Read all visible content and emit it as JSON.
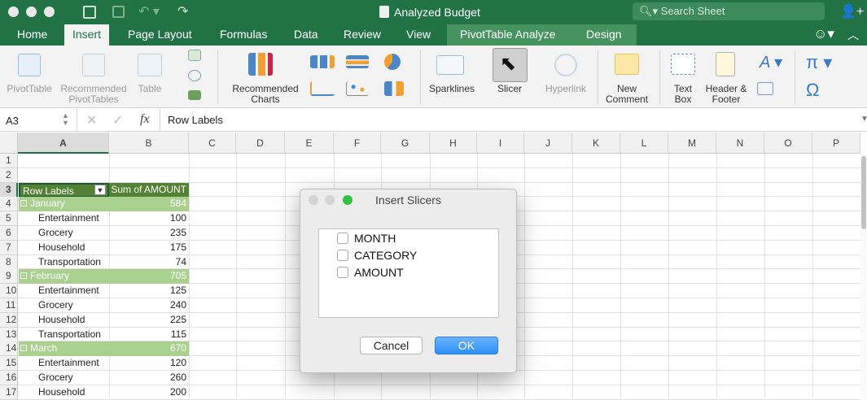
{
  "window": {
    "title": "Analyzed Budget",
    "search_placeholder": "Search Sheet"
  },
  "tabs": [
    "Home",
    "Insert",
    "Page Layout",
    "Formulas",
    "Data",
    "Review",
    "View",
    "PivotTable Analyze",
    "Design"
  ],
  "active_tab": "Insert",
  "ribbon": {
    "pivottable": "PivotTable",
    "recommended_pivottables": "Recommended\nPivotTables",
    "table": "Table",
    "recommended_charts": "Recommended\nCharts",
    "sparklines": "Sparklines",
    "slicer": "Slicer",
    "hyperlink": "Hyperlink",
    "new_comment": "New\nComment",
    "text_box": "Text\nBox",
    "header_footer": "Header &\nFooter"
  },
  "formula_bar": {
    "name_box": "A3",
    "fx": "fx",
    "content": "Row Labels"
  },
  "columns": [
    "A",
    "B",
    "C",
    "D",
    "E",
    "F",
    "G",
    "H",
    "I",
    "J",
    "K",
    "L",
    "M",
    "N",
    "O",
    "P"
  ],
  "rows": [
    {
      "n": "1",
      "a": "",
      "b": "",
      "type": "blank"
    },
    {
      "n": "2",
      "a": "",
      "b": "",
      "type": "blank"
    },
    {
      "n": "3",
      "a": "Row Labels",
      "b": "Sum of AMOUNT",
      "type": "header"
    },
    {
      "n": "4",
      "a": "January",
      "b": "584",
      "type": "month"
    },
    {
      "n": "5",
      "a": "Entertainment",
      "b": "100",
      "type": "item"
    },
    {
      "n": "6",
      "a": "Grocery",
      "b": "235",
      "type": "item"
    },
    {
      "n": "7",
      "a": "Household",
      "b": "175",
      "type": "item"
    },
    {
      "n": "8",
      "a": "Transportation",
      "b": "74",
      "type": "item"
    },
    {
      "n": "9",
      "a": "February",
      "b": "705",
      "type": "month"
    },
    {
      "n": "10",
      "a": "Entertainment",
      "b": "125",
      "type": "item"
    },
    {
      "n": "11",
      "a": "Grocery",
      "b": "240",
      "type": "item"
    },
    {
      "n": "12",
      "a": "Household",
      "b": "225",
      "type": "item"
    },
    {
      "n": "13",
      "a": "Transportation",
      "b": "115",
      "type": "item"
    },
    {
      "n": "14",
      "a": "March",
      "b": "670",
      "type": "month"
    },
    {
      "n": "15",
      "a": "Entertainment",
      "b": "120",
      "type": "item"
    },
    {
      "n": "16",
      "a": "Grocery",
      "b": "260",
      "type": "item"
    },
    {
      "n": "17",
      "a": "Household",
      "b": "200",
      "type": "item"
    }
  ],
  "dialog": {
    "title": "Insert Slicers",
    "fields": [
      "MONTH",
      "CATEGORY",
      "AMOUNT"
    ],
    "cancel": "Cancel",
    "ok": "OK"
  },
  "colors": {
    "brand": "#217346",
    "month_row": "#a9d08e",
    "header_row": "#548235",
    "ok_button": "#3b99fc"
  }
}
